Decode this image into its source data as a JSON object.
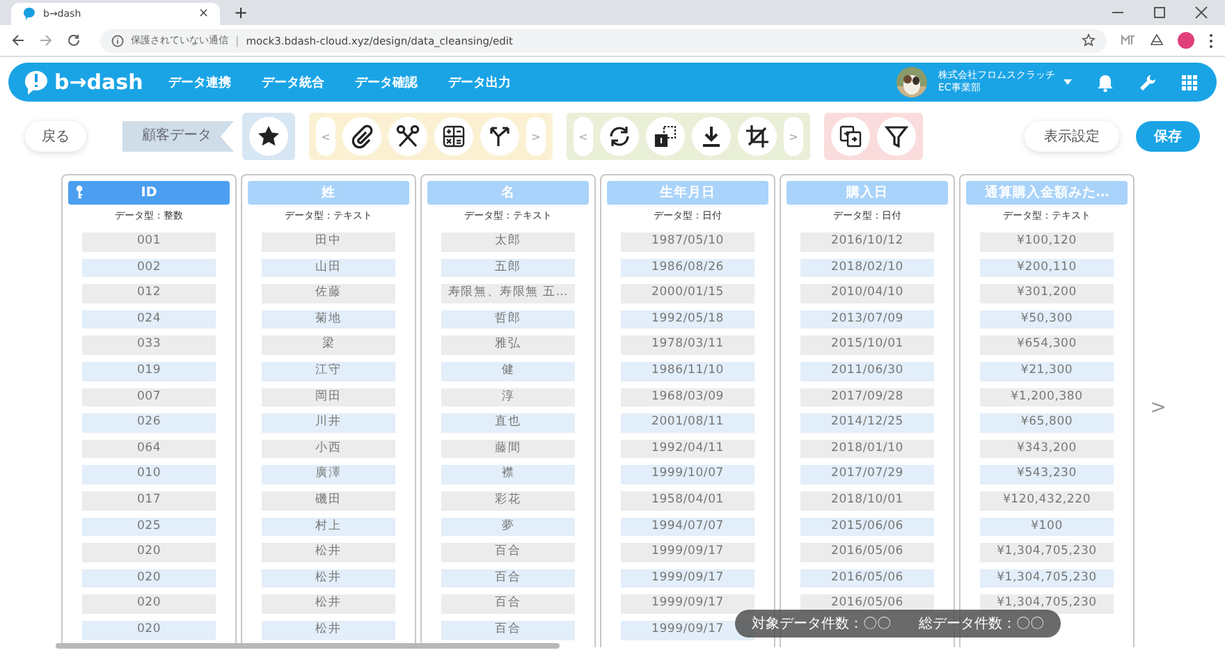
{
  "browser": {
    "tab_title": "b→dash",
    "tab_close": "×",
    "new_tab": "+",
    "security": "保護されていない通信",
    "separator": "|",
    "url": "mock3.bdash-cloud.xyz/design/data_cleansing/edit"
  },
  "header": {
    "logo": "b→dash",
    "nav": [
      "データ連携",
      "データ統合",
      "データ確認",
      "データ出力"
    ],
    "company": "株式会社フロムスクラッチ",
    "department": "EC事業部"
  },
  "toolbar": {
    "back": "戻る",
    "breadcrumb": "顧客データ",
    "groups": [
      {
        "color": "#d7e6f3",
        "tools": [
          {
            "kind": "star"
          }
        ]
      },
      {
        "color": "#fbf1d2",
        "prev": "<",
        "next": ">",
        "tools": [
          {
            "kind": "clip"
          },
          {
            "kind": "scissors"
          },
          {
            "kind": "calc"
          },
          {
            "kind": "split"
          }
        ]
      },
      {
        "color": "#eaf0d8",
        "prev": "<",
        "next": ">",
        "tools": [
          {
            "kind": "refresh"
          },
          {
            "kind": "number"
          },
          {
            "kind": "download"
          },
          {
            "kind": "crop"
          }
        ]
      },
      {
        "color": "#fbdcdc",
        "tools": [
          {
            "kind": "copy"
          },
          {
            "kind": "filter"
          }
        ]
      }
    ],
    "view_settings": "表示設定",
    "save": "保存"
  },
  "columns": [
    {
      "header": "ID",
      "key": true,
      "selected": true,
      "type": "データ型：整数",
      "cells": [
        "001",
        "002",
        "012",
        "024",
        "033",
        "019",
        "007",
        "026",
        "064",
        "010",
        "017",
        "025",
        "020",
        "020",
        "020",
        "020"
      ]
    },
    {
      "header": "姓",
      "key": false,
      "selected": false,
      "type": "データ型：テキスト",
      "cells": [
        "田中",
        "山田",
        "佐藤",
        "菊地",
        "梁",
        "江守",
        "岡田",
        "川井",
        "小西",
        "廣澤",
        "磯田",
        "村上",
        "松井",
        "松井",
        "松井",
        "松井"
      ]
    },
    {
      "header": "名",
      "key": false,
      "selected": false,
      "type": "データ型：テキスト",
      "cells": [
        "太郎",
        "五郎",
        "寿限無、寿限無 五…",
        "哲郎",
        "雅弘",
        "健",
        "淳",
        "直也",
        "藤間",
        "襟",
        "彩花",
        "夢",
        "百合",
        "百合",
        "百合",
        "百合"
      ]
    },
    {
      "header": "生年月日",
      "key": false,
      "selected": false,
      "type": "データ型：日付",
      "cells": [
        "1987/05/10",
        "1986/08/26",
        "2000/01/15",
        "1992/05/18",
        "1978/03/11",
        "1986/11/10",
        "1968/03/09",
        "2001/08/11",
        "1992/04/11",
        "1999/10/07",
        "1958/04/01",
        "1994/07/07",
        "1999/09/17",
        "1999/09/17",
        "1999/09/17",
        "1999/09/17"
      ]
    },
    {
      "header": "購入日",
      "key": false,
      "selected": false,
      "type": "データ型：日付",
      "cells": [
        "2016/10/12",
        "2018/02/10",
        "2010/04/10",
        "2013/07/09",
        "2015/10/01",
        "2011/06/30",
        "2017/09/28",
        "2014/12/25",
        "2018/01/10",
        "2017/07/29",
        "2018/10/01",
        "2015/06/06",
        "2016/05/06",
        "2016/05/06",
        "2016/05/06",
        null
      ]
    },
    {
      "header": "通算購入金額みた…",
      "key": false,
      "selected": false,
      "type": "データ型：テキスト",
      "cells": [
        "¥100,120",
        "¥200,110",
        "¥301,200",
        "¥50,300",
        "¥654,300",
        "¥21,300",
        "¥1,200,380",
        "¥65,800",
        "¥343,200",
        "¥543,230",
        "¥120,432,220",
        "¥100",
        "¥1,304,705,230",
        "¥1,304,705,230",
        "¥1,304,705,230",
        null
      ]
    }
  ],
  "scroll_next": ">",
  "summary": [
    "対象データ件数：〇〇",
    "総データ件数：〇〇"
  ]
}
